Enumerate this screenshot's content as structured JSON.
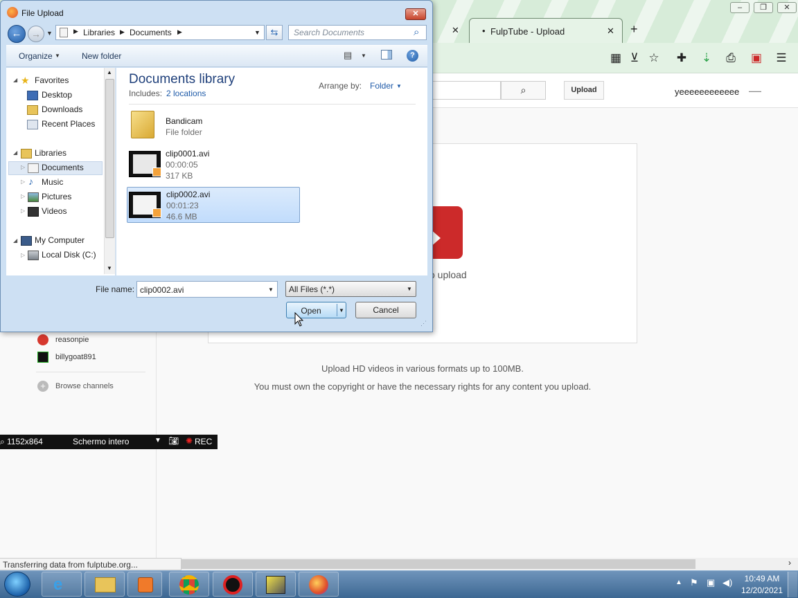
{
  "browser": {
    "tabs": [
      {
        "label": "",
        "active": false
      },
      {
        "label": "FulpTube - Upload",
        "active": true
      }
    ],
    "new_tab_symbol": "+",
    "window_controls": [
      "minimize",
      "restore",
      "close"
    ]
  },
  "site": {
    "upload_button": "Upload",
    "username": "yeeeeeeeeeeee",
    "drop_text_fragment": "o upload",
    "info_line_1": "Upload HD videos in various formats up to 100MB.",
    "info_line_2": "You must own the copyright or have the necessary rights for any content you upload.",
    "sidebar_channels": [
      {
        "name": "reasonpie",
        "icon": "santa-avatar-icon"
      },
      {
        "name": "billygoat891",
        "icon": "terminal-avatar-icon"
      }
    ],
    "browse_channels": "Browse channels",
    "brand_color": "#cc2a2a"
  },
  "status_bar": {
    "text": "Transferring data from fulptube.org..."
  },
  "recorder": {
    "resolution": "1152x864",
    "mode": "Schermo intero",
    "rec_label": "REC"
  },
  "dialog": {
    "title": "File Upload",
    "breadcrumb": [
      "Libraries",
      "Documents"
    ],
    "search_placeholder": "Search Documents",
    "toolbar": {
      "organize": "Organize",
      "new_folder": "New folder"
    },
    "nav": {
      "favorites": "Favorites",
      "favorites_items": [
        "Desktop",
        "Downloads",
        "Recent Places"
      ],
      "libraries": "Libraries",
      "libraries_items": [
        "Documents",
        "Music",
        "Pictures",
        "Videos"
      ],
      "computer": "My Computer",
      "computer_items": [
        "Local Disk (C:)"
      ]
    },
    "library": {
      "title": "Documents library",
      "includes_label": "Includes:",
      "includes_link": "2 locations",
      "arrange_label": "Arrange by:",
      "arrange_value": "Folder"
    },
    "files": [
      {
        "name": "Bandicam",
        "line2": "File folder",
        "line3": "",
        "type": "folder",
        "selected": false
      },
      {
        "name": "clip0001.avi",
        "line2": "00:00:05",
        "line3": "317 KB",
        "type": "video",
        "selected": false
      },
      {
        "name": "clip0002.avi",
        "line2": "00:01:23",
        "line3": "46.6 MB",
        "type": "video",
        "selected": true
      }
    ],
    "filename_label": "File name:",
    "filename_value": "clip0002.avi",
    "filetype_value": "All Files (*.*)",
    "open_button": "Open",
    "cancel_button": "Cancel",
    "accent_color": "#1e5aa8"
  },
  "taskbar": {
    "time": "10:49 AM",
    "date": "12/20/2021",
    "apps": [
      "start-orb-icon",
      "internet-explorer-icon",
      "file-explorer-icon",
      "media-player-icon",
      "chrome-icon",
      "bandicam-icon",
      "flash-icon",
      "firefox-icon"
    ]
  }
}
